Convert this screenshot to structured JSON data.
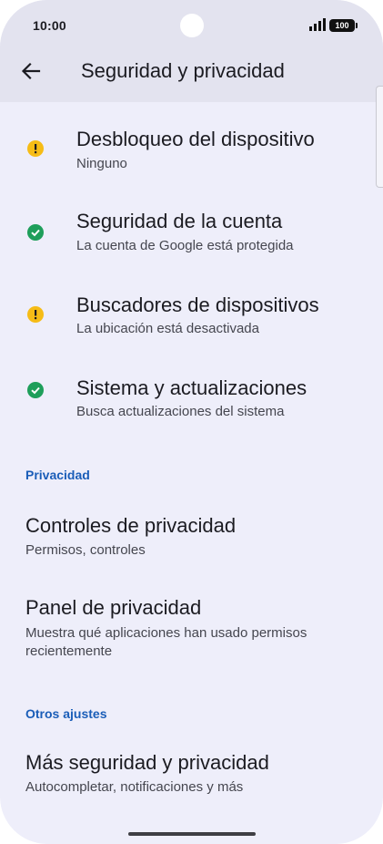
{
  "status_bar": {
    "time": "10:00",
    "battery": "100"
  },
  "header": {
    "title": "Seguridad y privacidad"
  },
  "security_items": [
    {
      "title": "Desbloqueo del dispositivo",
      "subtitle": "Ninguno",
      "status": "warning",
      "icon": "warning-icon"
    },
    {
      "title": "Seguridad de la cuenta",
      "subtitle": "La cuenta de Google está protegida",
      "status": "ok",
      "icon": "check-icon"
    },
    {
      "title": "Buscadores de dispositivos",
      "subtitle": "La ubicación está desactivada",
      "status": "warning",
      "icon": "warning-icon"
    },
    {
      "title": "Sistema y actualizaciones",
      "subtitle": "Busca actualizaciones del sistema",
      "status": "ok",
      "icon": "check-icon"
    }
  ],
  "privacy_section": {
    "header": "Privacidad",
    "items": [
      {
        "title": "Controles de privacidad",
        "subtitle": "Permisos, controles"
      },
      {
        "title": "Panel de privacidad",
        "subtitle": "Muestra qué aplicaciones han usado permisos recientemente"
      }
    ]
  },
  "other_section": {
    "header": "Otros ajustes",
    "items": [
      {
        "title": "Más seguridad y privacidad",
        "subtitle": "Autocompletar, notificaciones y más"
      }
    ]
  },
  "colors": {
    "background": "#eeeefa",
    "header_background": "#e3e3ef",
    "warning": "#f6bc16",
    "ok": "#1e9e5a",
    "section_header": "#1a5db8"
  }
}
